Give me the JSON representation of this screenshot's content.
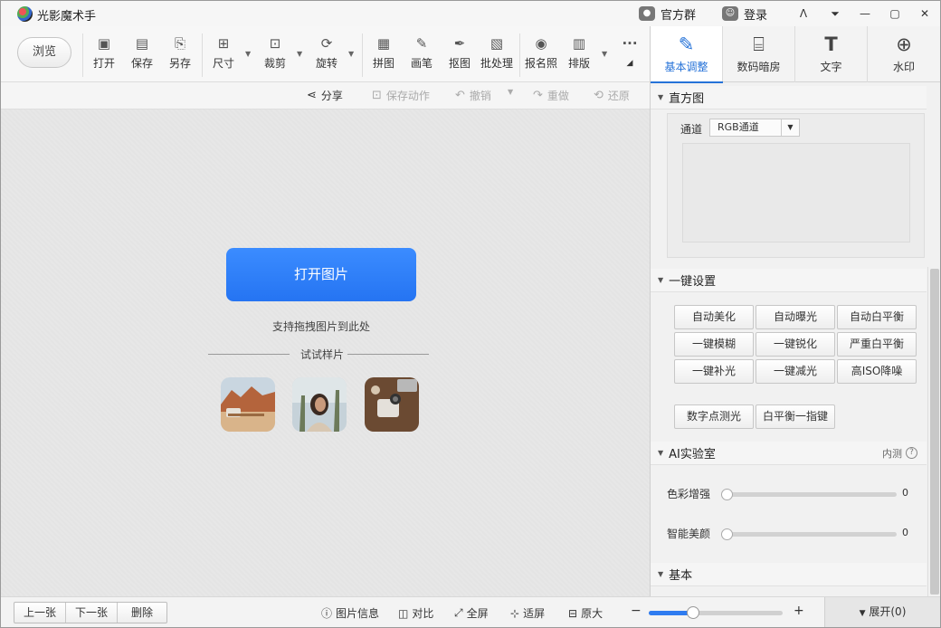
{
  "app": {
    "title": "光影魔术手"
  },
  "titlebar": {
    "official_group": "官方群",
    "login": "登录"
  },
  "toolbar": {
    "browse": "浏览",
    "tools": [
      {
        "id": "open",
        "label": "打开",
        "icon": "▣"
      },
      {
        "id": "save",
        "label": "保存",
        "icon": "▤"
      },
      {
        "id": "saveas",
        "label": "另存",
        "icon": "⎘"
      },
      {
        "id": "size",
        "label": "尺寸",
        "icon": "⊞"
      },
      {
        "id": "crop",
        "label": "裁剪",
        "icon": "⊡"
      },
      {
        "id": "rotate",
        "label": "旋转",
        "icon": "⟳"
      },
      {
        "id": "collage",
        "label": "拼图",
        "icon": "▦"
      },
      {
        "id": "brush",
        "label": "画笔",
        "icon": "✎"
      },
      {
        "id": "cutout",
        "label": "抠图",
        "icon": "✒"
      },
      {
        "id": "batch",
        "label": "批处理",
        "icon": "▧"
      },
      {
        "id": "idphoto",
        "label": "报名照",
        "icon": "◉"
      },
      {
        "id": "layout",
        "label": "排版",
        "icon": "▥"
      }
    ],
    "more": "···"
  },
  "actionbar": {
    "share": "分享",
    "save_action": "保存动作",
    "undo": "撤销",
    "redo": "重做",
    "restore": "还原"
  },
  "canvas": {
    "open_image": "打开图片",
    "drag_hint": "支持拖拽图片到此处",
    "try_samples": "试试样片"
  },
  "bottombar": {
    "prev": "上一张",
    "next": "下一张",
    "delete": "删除",
    "info": "图片信息",
    "compare": "对比",
    "fullscreen": "全屏",
    "fit": "适屏",
    "original": "原大",
    "zoom_minus": "−",
    "zoom_plus": "+",
    "zoom_level": 0.33,
    "expand": "展开(0)"
  },
  "rpanel": {
    "tabs": [
      {
        "label": "基本调整",
        "icon": "✎",
        "active": true
      },
      {
        "label": "数码暗房",
        "icon": "⌸",
        "active": false
      },
      {
        "label": "文字",
        "icon": "T",
        "active": false
      },
      {
        "label": "水印",
        "icon": "⊕",
        "active": false
      }
    ],
    "histogram": {
      "title": "直方图",
      "channel_label": "通道",
      "channel_value": "RGB通道"
    },
    "oneclick": {
      "title": "一键设置",
      "buttons": [
        "自动美化",
        "自动曝光",
        "自动白平衡",
        "一键模糊",
        "一键锐化",
        "严重白平衡",
        "一键补光",
        "一键减光",
        "高ISO降噪"
      ],
      "extra_buttons": [
        "数字点测光",
        "白平衡一指键"
      ]
    },
    "ai_lab": {
      "title": "AI实验室",
      "beta": "内测",
      "sliders": [
        {
          "label": "色彩增强",
          "value": "0"
        },
        {
          "label": "智能美颜",
          "value": "0"
        }
      ]
    },
    "basic": {
      "title": "基本"
    }
  },
  "colors": {
    "accent": "#2572d8",
    "primary_button": "#2f7cf4"
  }
}
